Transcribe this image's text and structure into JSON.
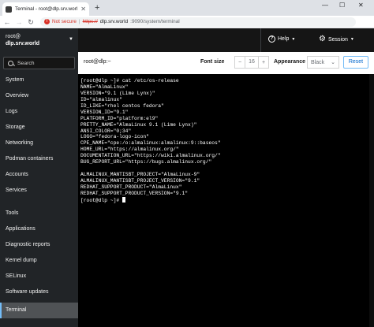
{
  "browser": {
    "tab_title": "Terminal - root@dlp.srv.world",
    "new_tab": "+",
    "window_controls": {
      "minimize": "—",
      "maximize": "☐",
      "close": "✕"
    },
    "not_secure": "Not secure",
    "address_scheme": "https://",
    "address_host": "dlp.srv.world",
    "address_path": ":9090/system/terminal"
  },
  "header": {
    "user": "root@",
    "host": "dlp.srv.world",
    "help_label": "Help",
    "session_label": "Session"
  },
  "sidebar": {
    "search_placeholder": "Search",
    "items": [
      {
        "label": "System"
      },
      {
        "label": "Overview"
      },
      {
        "label": "Logs"
      },
      {
        "label": "Storage"
      },
      {
        "label": "Networking"
      },
      {
        "label": "Podman containers"
      },
      {
        "label": "Accounts"
      },
      {
        "label": "Services"
      },
      {
        "label": "Tools"
      },
      {
        "label": "Applications"
      },
      {
        "label": "Diagnostic reports"
      },
      {
        "label": "Kernel dump"
      },
      {
        "label": "SELinux"
      },
      {
        "label": "Software updates"
      },
      {
        "label": "Terminal",
        "active": true
      }
    ]
  },
  "terminal_header": {
    "title": "root@dlp:~",
    "font_size_label": "Font size",
    "font_size_minus": "−",
    "font_size_value": "16",
    "font_size_plus": "+",
    "appearance_label": "Appearance",
    "appearance_value": "Black",
    "reset_label": "Reset"
  },
  "terminal": {
    "lines": [
      "[root@dlp ~]# cat /etc/os-release",
      "NAME=\"AlmaLinux\"",
      "VERSION=\"9.1 (Lime Lynx)\"",
      "ID=\"almalinux\"",
      "ID_LIKE=\"rhel centos fedora\"",
      "VERSION_ID=\"9.1\"",
      "PLATFORM_ID=\"platform:el9\"",
      "PRETTY_NAME=\"AlmaLinux 9.1 (Lime Lynx)\"",
      "ANSI_COLOR=\"0;34\"",
      "LOGO=\"fedora-logo-icon\"",
      "CPE_NAME=\"cpe:/o:almalinux:almalinux:9::baseos\"",
      "HOME_URL=\"https://almalinux.org/\"",
      "DOCUMENTATION_URL=\"https://wiki.almalinux.org/\"",
      "BUG_REPORT_URL=\"https://bugs.almalinux.org/\"",
      "",
      "ALMALINUX_MANTISBT_PROJECT=\"AlmaLinux-9\"",
      "ALMALINUX_MANTISBT_PROJECT_VERSION=\"9.1\"",
      "REDHAT_SUPPORT_PRODUCT=\"AlmaLinux\"",
      "REDHAT_SUPPORT_PRODUCT_VERSION=\"9.1\""
    ],
    "prompt": "[root@dlp ~]# "
  }
}
